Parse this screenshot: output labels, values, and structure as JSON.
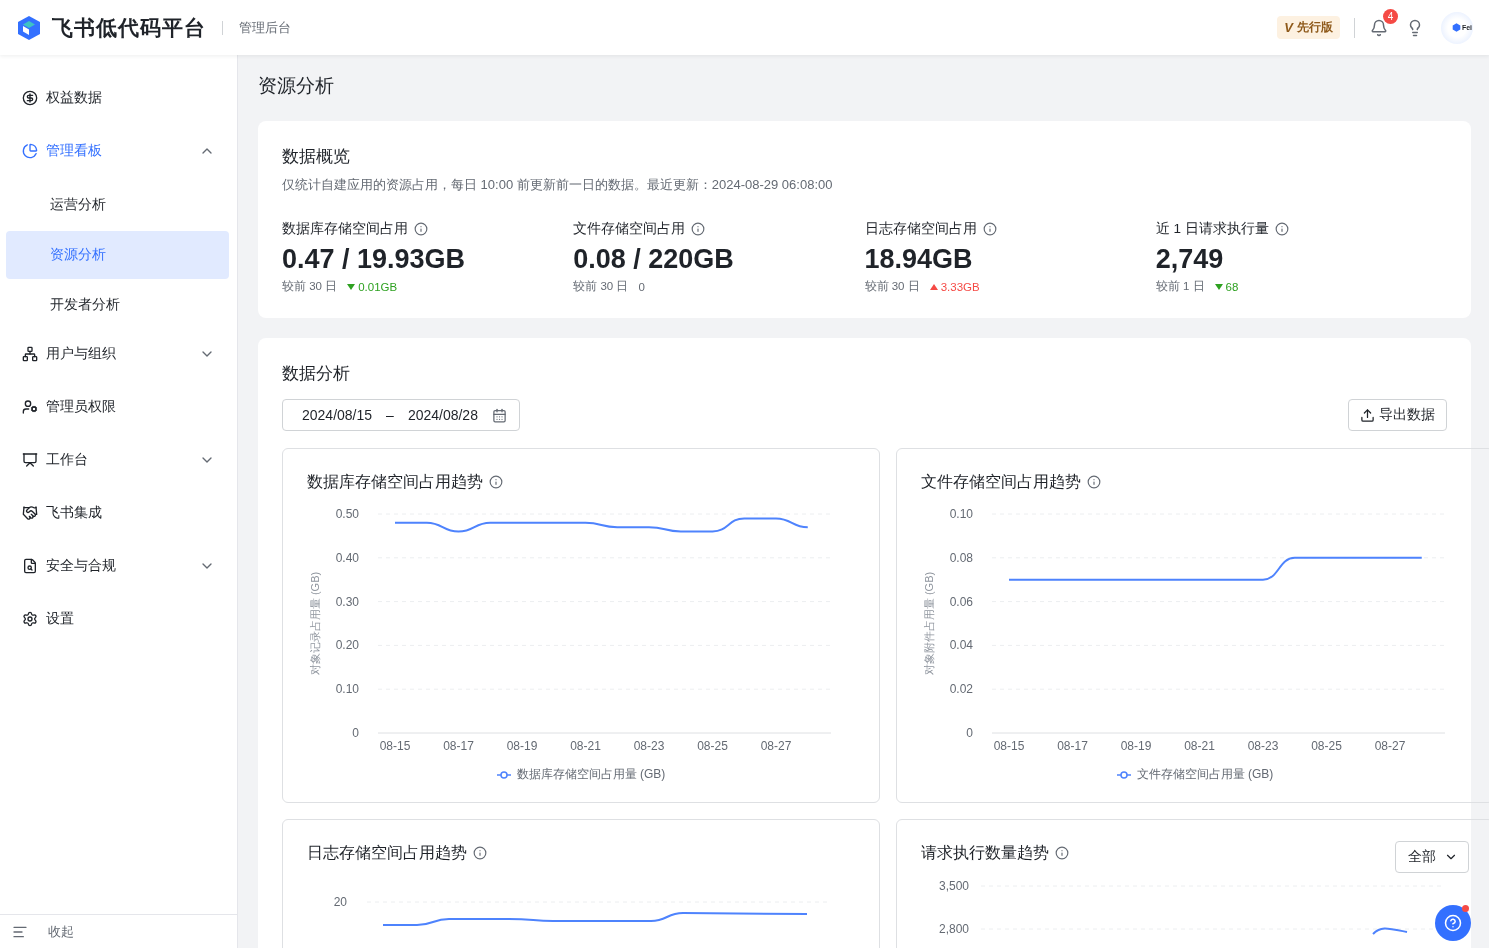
{
  "header": {
    "product": "飞书低代码平台",
    "section": "管理后台",
    "edition_badge": {
      "mark": "V",
      "label": "先行版"
    },
    "notification_count": "4",
    "avatar_text": "Fei"
  },
  "sidebar": {
    "items": [
      {
        "label": "权益数据",
        "selected": false
      },
      {
        "label": "管理看板",
        "selected": false,
        "expanded": true,
        "children": [
          {
            "label": "运营分析",
            "selected": false
          },
          {
            "label": "资源分析",
            "selected": true
          },
          {
            "label": "开发者分析",
            "selected": false
          }
        ]
      },
      {
        "label": "用户与组织",
        "selected": false,
        "expanded": false
      },
      {
        "label": "管理员权限",
        "selected": false
      },
      {
        "label": "工作台",
        "selected": false,
        "expanded": false
      },
      {
        "label": "飞书集成",
        "selected": false
      },
      {
        "label": "安全与合规",
        "selected": false,
        "expanded": false
      },
      {
        "label": "设置",
        "selected": false
      }
    ],
    "collapse_label": "收起"
  },
  "page_title": "资源分析",
  "overview": {
    "title": "数据概览",
    "description": "仅统计自建应用的资源占用，每日 10:00 前更新前一日的数据。最近更新：2024-08-29 06:08:00",
    "stats": [
      {
        "label": "数据库存储空间占用",
        "value": "0.47 / 19.93GB",
        "compare": "较前 30 日",
        "kind": "decrease",
        "delta": "0.01GB"
      },
      {
        "label": "文件存储空间占用",
        "value": "0.08 / 220GB",
        "compare": "较前 30 日",
        "kind": "flat",
        "delta": "0"
      },
      {
        "label": "日志存储空间占用",
        "value": "18.94GB",
        "compare": "较前 30 日",
        "kind": "increase",
        "delta": "3.33GB"
      },
      {
        "label": "近 1 日请求执行量",
        "value": "2,749",
        "compare": "较前 1 日",
        "kind": "decrease",
        "delta": "68"
      }
    ]
  },
  "analysis": {
    "title": "数据分析",
    "date_range": {
      "start": "2024/08/15",
      "separator": "–",
      "end": "2024/08/28"
    },
    "export_button": "导出数据",
    "charts": [
      {
        "title": "数据库存储空间占用趋势",
        "chart_data": {
          "type": "line",
          "ylabel": "对象记录占用量 (GB)",
          "grid": true,
          "categories": [
            "08-15",
            null,
            "08-17",
            null,
            "08-19",
            null,
            "08-21",
            null,
            "08-23",
            null,
            "08-25",
            null,
            "08-27",
            null
          ],
          "series": [
            {
              "name": "数据库存储空间占用量 (GB)",
              "color": "#4e83fd",
              "values": [
                0.48,
                0.48,
                0.46,
                0.48,
                0.48,
                0.48,
                0.48,
                0.47,
                0.47,
                0.46,
                0.46,
                0.49,
                0.49,
                0.47
              ]
            }
          ],
          "ylim": [
            0,
            0.5
          ],
          "yticks": [
            {
              "value": 0,
              "label": "0"
            },
            {
              "value": 0.1,
              "label": "0.10"
            },
            {
              "value": 0.2,
              "label": "0.20"
            },
            {
              "value": 0.3,
              "label": "0.30"
            },
            {
              "value": 0.4,
              "label": "0.40"
            },
            {
              "value": 0.5,
              "label": "0.50"
            }
          ]
        }
      },
      {
        "title": "文件存储空间占用趋势",
        "chart_data": {
          "type": "line",
          "ylabel": "对象附件占用量 (GB)",
          "grid": true,
          "categories": [
            "08-15",
            null,
            "08-17",
            null,
            "08-19",
            null,
            "08-21",
            null,
            "08-23",
            null,
            "08-25",
            null,
            "08-27",
            null
          ],
          "series": [
            {
              "name": "文件存储空间占用量 (GB)",
              "color": "#4e83fd",
              "values": [
                0.07,
                0.07,
                0.07,
                0.07,
                0.07,
                0.07,
                0.07,
                0.07,
                0.07,
                0.08,
                0.08,
                0.08,
                0.08,
                0.08
              ]
            }
          ],
          "ylim": [
            0,
            0.1
          ],
          "yticks": [
            {
              "value": 0,
              "label": "0"
            },
            {
              "value": 0.02,
              "label": "0.02"
            },
            {
              "value": 0.04,
              "label": "0.04"
            },
            {
              "value": 0.06,
              "label": "0.06"
            },
            {
              "value": 0.08,
              "label": "0.08"
            },
            {
              "value": 0.1,
              "label": "0.10"
            }
          ]
        }
      }
    ],
    "partial_charts": [
      {
        "title": "日志存储空间占用趋势",
        "kind": "log",
        "ytick_labels": [
          "20"
        ]
      },
      {
        "title": "请求执行数量趋势",
        "kind": "requests",
        "ytick_labels": [
          "3,500",
          "2,800"
        ],
        "filter": "全部"
      }
    ]
  }
}
